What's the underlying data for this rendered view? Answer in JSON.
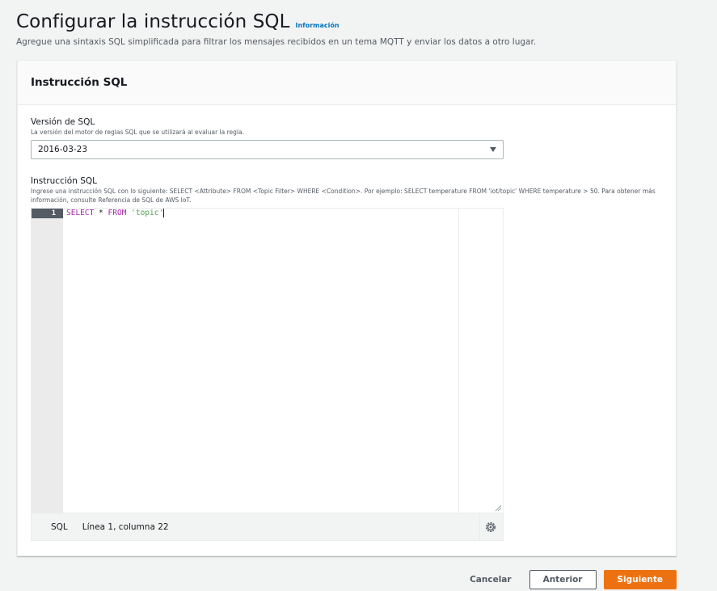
{
  "header": {
    "title": "Configurar la instrucción SQL",
    "info_link": "Información",
    "description": "Agregue una sintaxis SQL simplificada para filtrar los mensajes recibidos en un tema MQTT y enviar los datos a otro lugar."
  },
  "panel": {
    "title": "Instrucción SQL",
    "sql_version": {
      "label": "Versión de SQL",
      "description": "La versión del motor de reglas SQL que se utilizará al evaluar la regla.",
      "selected": "2016-03-23"
    },
    "sql_statement": {
      "label": "Instrucción SQL",
      "description": "Ingrese una instrucción SQL con lo siguiente: SELECT <Attribute> FROM <Topic Filter> WHERE <Condition>. Por ejemplo: SELECT temperature FROM 'iot/topic' WHERE temperature > 50. Para obtener más información, consulte Referencia de SQL de AWS IoT."
    },
    "editor": {
      "line_number": "1",
      "code": {
        "kw1": "SELECT",
        "middle": " * ",
        "kw2": "FROM",
        "space": " ",
        "string": "'topic'"
      },
      "status_language": "SQL",
      "status_position": "Línea 1, columna 22",
      "icons": [
        "resize-handle-icon",
        "settings-icon"
      ]
    }
  },
  "actions": {
    "cancel": "Cancelar",
    "previous": "Anterior",
    "next": "Siguiente"
  },
  "colors": {
    "accent": "#ec7211",
    "link": "#0073bb",
    "keyword": "#a626a4",
    "string": "#50a14f"
  }
}
